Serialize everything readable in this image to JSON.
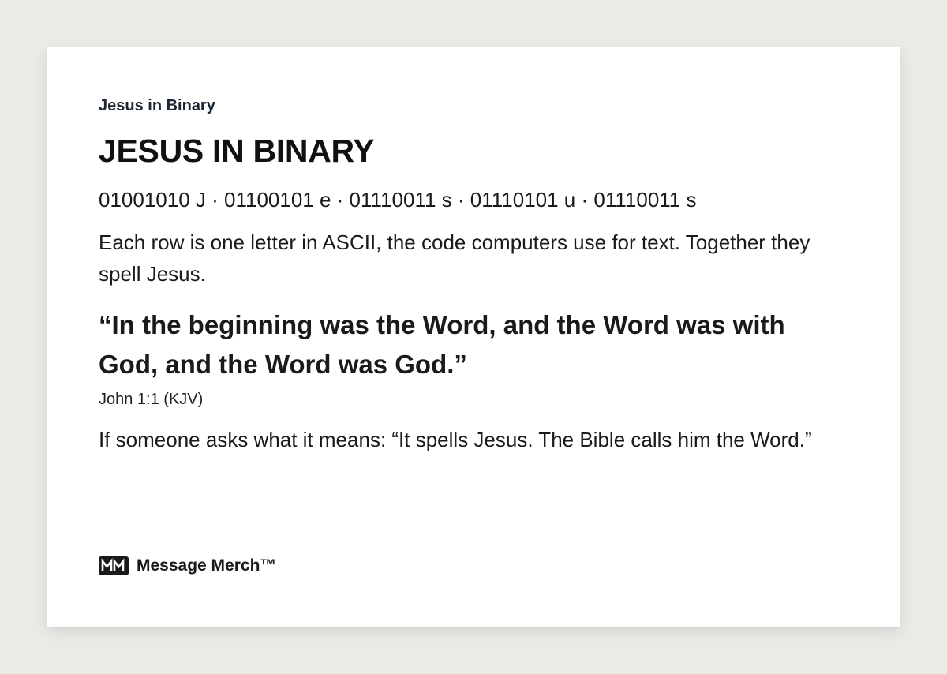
{
  "header": {
    "eyebrow": "Jesus in Binary",
    "title": "JESUS IN BINARY"
  },
  "binary_line": "01001010 J · 01100101 e · 01110011 s · 01110101 u · 01110011 s",
  "explanation": "Each row is one letter in ASCII, the code computers use for text. Together they spell Jesus.",
  "quote": {
    "text": "“In the beginning was the Word, and the Word was with God, and the Word was God.”",
    "citation": "John 1:1 (KJV)"
  },
  "note": "If someone asks what it means: “It spells Jesus. The Bible calls him the Word.”",
  "footer": {
    "brand_name": "Message Merch™",
    "logo_icon": "mm-logo-icon"
  },
  "colors": {
    "background": "#ebeae6",
    "card": "#ffffff",
    "eyebrow_text": "#1d2633",
    "divider": "#c9ccd1",
    "text": "#1a1a1a"
  }
}
